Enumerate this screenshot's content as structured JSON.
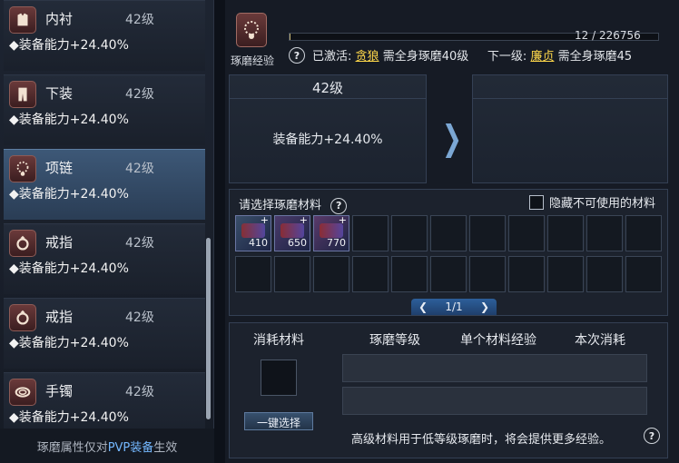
{
  "left_items": [
    {
      "name": "内衬",
      "level": "42级",
      "stat": "◆装备能力+24.40%",
      "icon": "shirt-icon"
    },
    {
      "name": "下装",
      "level": "42级",
      "stat": "◆装备能力+24.40%",
      "icon": "pants-icon"
    },
    {
      "name": "项链",
      "level": "42级",
      "stat": "◆装备能力+24.40%",
      "icon": "necklace-icon"
    },
    {
      "name": "戒指",
      "level": "42级",
      "stat": "◆装备能力+24.40%",
      "icon": "ring-icon"
    },
    {
      "name": "戒指",
      "level": "42级",
      "stat": "◆装备能力+24.40%",
      "icon": "ring-icon"
    },
    {
      "name": "手镯",
      "level": "42级",
      "stat": "◆装备能力+24.40%",
      "icon": "bracelet-icon"
    }
  ],
  "selected_index": 2,
  "footnote": {
    "prefix": "琢磨属性仅对",
    "highlight": "PVP装备",
    "suffix": "生效"
  },
  "top": {
    "label": "琢磨经验",
    "help": "?",
    "exp_text": "12 / 226756",
    "exp_fraction": 0.0001,
    "activated_prefix": "已激活:",
    "activated_link": "贪狼",
    "activated_suffix": "需全身琢磨40级",
    "next_prefix": "下一级:",
    "next_link": "廉贞",
    "next_suffix": "需全身琢磨45"
  },
  "current": {
    "level": "42级",
    "stat": "装备能力+24.40%"
  },
  "next_box": {
    "level": "",
    "stat": ""
  },
  "arrow": "❯",
  "materials": {
    "label": "请选择琢磨材料",
    "help": "?",
    "hide_label": "隐藏不可使用的材料",
    "filled": [
      {
        "count": "410",
        "tint": "#3a4f6a"
      },
      {
        "count": "650",
        "tint": "#4a3a6a"
      },
      {
        "count": "770",
        "tint": "#5a3a6a"
      }
    ],
    "pager": {
      "prev": "❮",
      "text": "1/1",
      "next": "❯"
    }
  },
  "bottom": {
    "col_consume": "消耗材料",
    "col_level": "琢磨等级",
    "col_single_exp": "单个材料经验",
    "col_cost": "本次消耗",
    "one_key": "一键选择",
    "hint": "高级材料用于低等级琢磨时，将会提供更多经验。",
    "help": "?"
  }
}
